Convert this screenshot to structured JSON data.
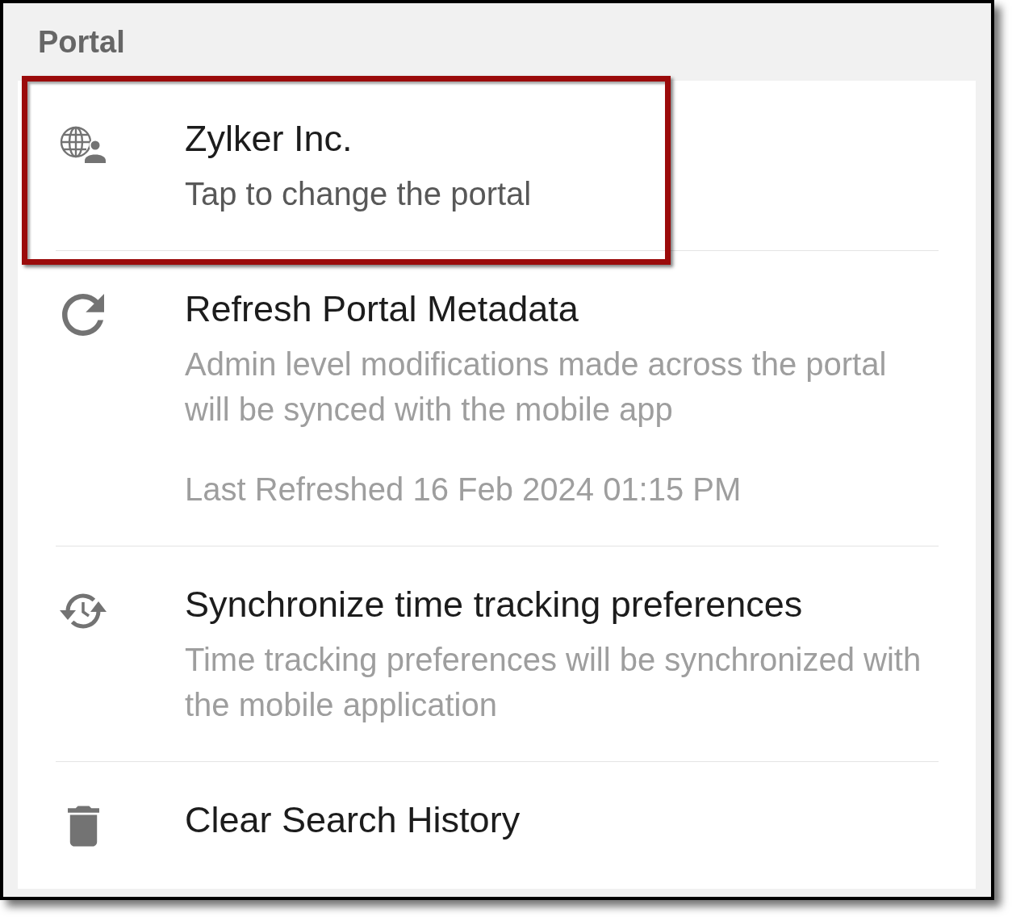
{
  "header": {
    "title": "Portal"
  },
  "items": [
    {
      "kind": "portal",
      "title": "Zylker Inc.",
      "subtitle": "Tap to change the portal",
      "highlighted": true
    },
    {
      "kind": "refresh",
      "title": "Refresh Portal Metadata",
      "description": "Admin level modifications made across the portal will be synced with the mobile app",
      "note": "Last Refreshed 16 Feb 2024 01:15 PM",
      "highlighted": false
    },
    {
      "kind": "sync",
      "title": "Synchronize time tracking preferences",
      "description": "Time tracking preferences will be synchronized with the mobile application",
      "highlighted": false
    },
    {
      "kind": "clear",
      "title": "Clear Search History",
      "highlighted": false
    }
  ]
}
